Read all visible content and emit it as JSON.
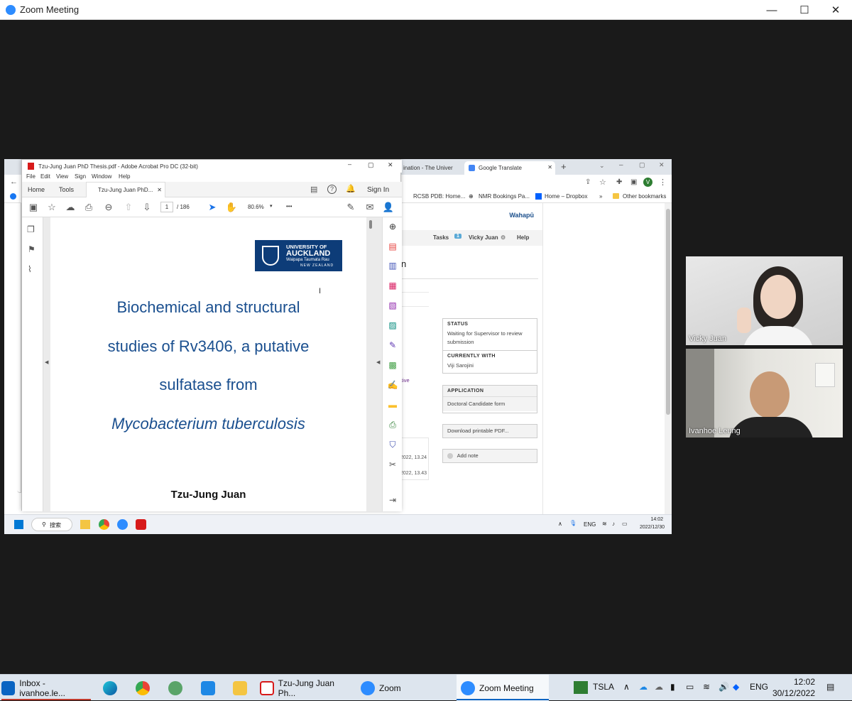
{
  "zoom_window": {
    "title": "Zoom Meeting",
    "controls": {
      "minimize": "—",
      "maximize": "☐",
      "close": "✕"
    }
  },
  "browser": {
    "tabs": [
      {
        "label": "ination - The Univer"
      },
      {
        "label": "Google Translate"
      }
    ],
    "new_tab": "+",
    "bookmarks": [
      {
        "label": "RCSB PDB: Home..."
      },
      {
        "label": "NMR Bookings Pa..."
      },
      {
        "label": "Home – Dropbox"
      },
      {
        "label": "»"
      },
      {
        "label": "Other bookmarks"
      }
    ],
    "profile_initial": "V"
  },
  "webpage": {
    "brand": "Wahapū",
    "nav": {
      "tasks": "Tasks",
      "tasks_count": "1",
      "user": "Vicky Juan",
      "help": "Help"
    },
    "heading_fragment": "n",
    "status_label": "STATUS",
    "status_text": "Waiting for Supervisor to review submission",
    "currently_with_label": "CURRENTLY WITH",
    "currently_with": "Viji Sarojini",
    "application_label": "APPLICATION",
    "application": "Doctoral Candidate form",
    "download_button": "Download printable PDF...",
    "add_note_button": "Add note",
    "fragment_ive": "tive",
    "date1": "2022, 13.24",
    "date2": "2022, 13.43"
  },
  "acrobat": {
    "title": "Tzu-Jung Juan PhD Thesis.pdf - Adobe Acrobat Pro DC (32-bit)",
    "menu": [
      "File",
      "Edit",
      "View",
      "Sign",
      "Window",
      "Help"
    ],
    "tabs": {
      "home": "Home",
      "tools": "Tools",
      "doc": "Tzu-Jung Juan PhD...",
      "sign_in": "Sign In"
    },
    "page_current": "1",
    "page_total": "/ 186",
    "zoom": "80.6%",
    "more": "•••"
  },
  "pdf_page": {
    "logo_line1": "UNIVERSITY OF",
    "logo_line2": "AUCKLAND",
    "logo_line3": "Waipapa Taumata Rau",
    "logo_line4": "NEW ZEALAND",
    "title_line1": "Biochemical and structural",
    "title_line2": "studies of Rv3406, a putative",
    "title_line3": "sulfatase from",
    "title_line4": "Mycobacterium tuberculosis",
    "author": "Tzu-Jung Juan"
  },
  "inner_taskbar": {
    "search": "搜索",
    "lang": "ENG",
    "time": "14:02",
    "date": "2022/12/30"
  },
  "participants": [
    {
      "name": "Vicky Juan"
    },
    {
      "name": "Ivanhoe Leung"
    }
  ],
  "taskbar": {
    "items": [
      {
        "label": "Inbox - ivanhoe.le..."
      },
      {
        "label": "Tzu-Jung Juan Ph..."
      },
      {
        "label": "Zoom"
      },
      {
        "label": "Zoom Meeting"
      }
    ],
    "stock": "TSLA",
    "lang": "ENG",
    "time": "12:02",
    "date": "30/12/2022"
  },
  "colors": {
    "zoom_blue": "#2d8cff",
    "uoa_navy": "#0d3c78",
    "thesis_blue": "#1a4f8f",
    "taskbar": "#dde5ee"
  }
}
